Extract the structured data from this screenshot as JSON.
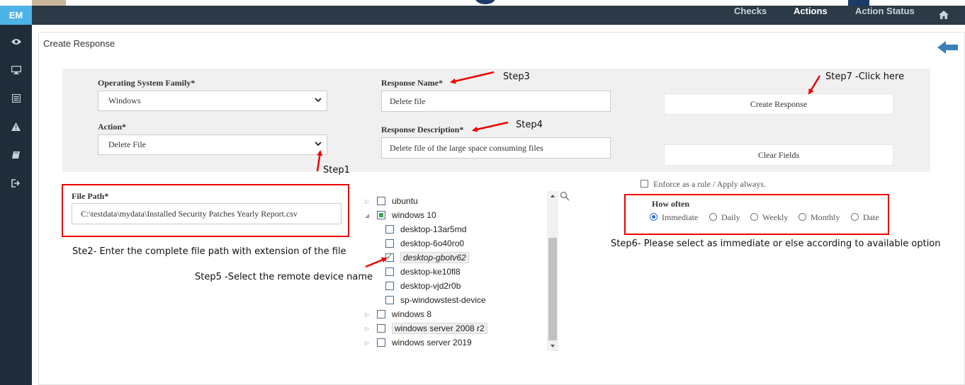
{
  "sidebar": {
    "brand": "EM",
    "items": [
      {
        "icon": "eye-icon",
        "name": "sidebar-item-monitor"
      },
      {
        "icon": "desktop-icon",
        "name": "sidebar-item-devices"
      },
      {
        "icon": "list-icon",
        "name": "sidebar-item-reports"
      },
      {
        "icon": "warning-icon",
        "name": "sidebar-item-alerts"
      },
      {
        "icon": "book-icon",
        "name": "sidebar-item-docs"
      },
      {
        "icon": "sign-out-icon",
        "name": "sidebar-item-logout"
      }
    ]
  },
  "topnav": {
    "checks": "Checks",
    "actions": "Actions",
    "action_status": "Action Status",
    "home_icon": "home-icon"
  },
  "panel": {
    "title": "Create Response",
    "back_icon": "arrow-left-icon"
  },
  "form": {
    "os_family_label": "Operating System Family*",
    "os_family_value": "Windows",
    "action_label": "Action*",
    "action_value": "Delete File",
    "response_name_label": "Response Name*",
    "response_name_value": "Delete file",
    "response_desc_label": "Response Description*",
    "response_desc_value": "Delete file of the large space consuming files",
    "create_button": "Create Response",
    "clear_button": "Clear Fields",
    "file_path_label": "File Path*",
    "file_path_value": "C:\\testdata\\mydata\\Installed Security Patches Yearly Report.csv",
    "enforce_label": "Enforce as a rule / Apply always.",
    "how_often_label": "How often",
    "how_often_options": [
      "Immediate",
      "Daily",
      "Weekly",
      "Monthly",
      "Date"
    ],
    "how_often_selected": "Immediate"
  },
  "tree": [
    {
      "label": "ubuntu",
      "level": 0,
      "toggle": "collapsed",
      "state": "unchecked"
    },
    {
      "label": "windows 10",
      "level": 0,
      "toggle": "expanded",
      "state": "partial"
    },
    {
      "label": "desktop-13ar5md",
      "level": 1,
      "state": "unchecked"
    },
    {
      "label": "desktop-6o40ro0",
      "level": 1,
      "state": "unchecked"
    },
    {
      "label": "desktop-gbotv62",
      "level": 1,
      "state": "checked"
    },
    {
      "label": "desktop-ke10fl8",
      "level": 1,
      "state": "unchecked"
    },
    {
      "label": "desktop-vjd2r0b",
      "level": 1,
      "state": "unchecked"
    },
    {
      "label": "sp-windowstest-device",
      "level": 1,
      "state": "unchecked"
    },
    {
      "label": "windows 8",
      "level": 0,
      "toggle": "collapsed",
      "state": "unchecked"
    },
    {
      "label": "windows server 2008 r2",
      "level": 0,
      "toggle": "collapsed",
      "state": "unchecked"
    },
    {
      "label": "windows server 2019",
      "level": 0,
      "toggle": "collapsed",
      "state": "unchecked"
    }
  ],
  "annotations": {
    "step1": "Step1",
    "step2": "Ste2- Enter the complete file path with extension of the file",
    "step3": "Step3",
    "step4": "Step4",
    "step5": "Step5 -Select the remote device name",
    "step6": "Step6- Please select as immediate or else according to available option",
    "step7": "Step7 -Click here"
  },
  "colors": {
    "sidebar_bg": "#1f2d3a",
    "brand_bg": "#4db3e6",
    "topnav_bg": "#2b3a46",
    "annotation_red": "#e00000",
    "back_arrow": "#3a7fb5"
  }
}
